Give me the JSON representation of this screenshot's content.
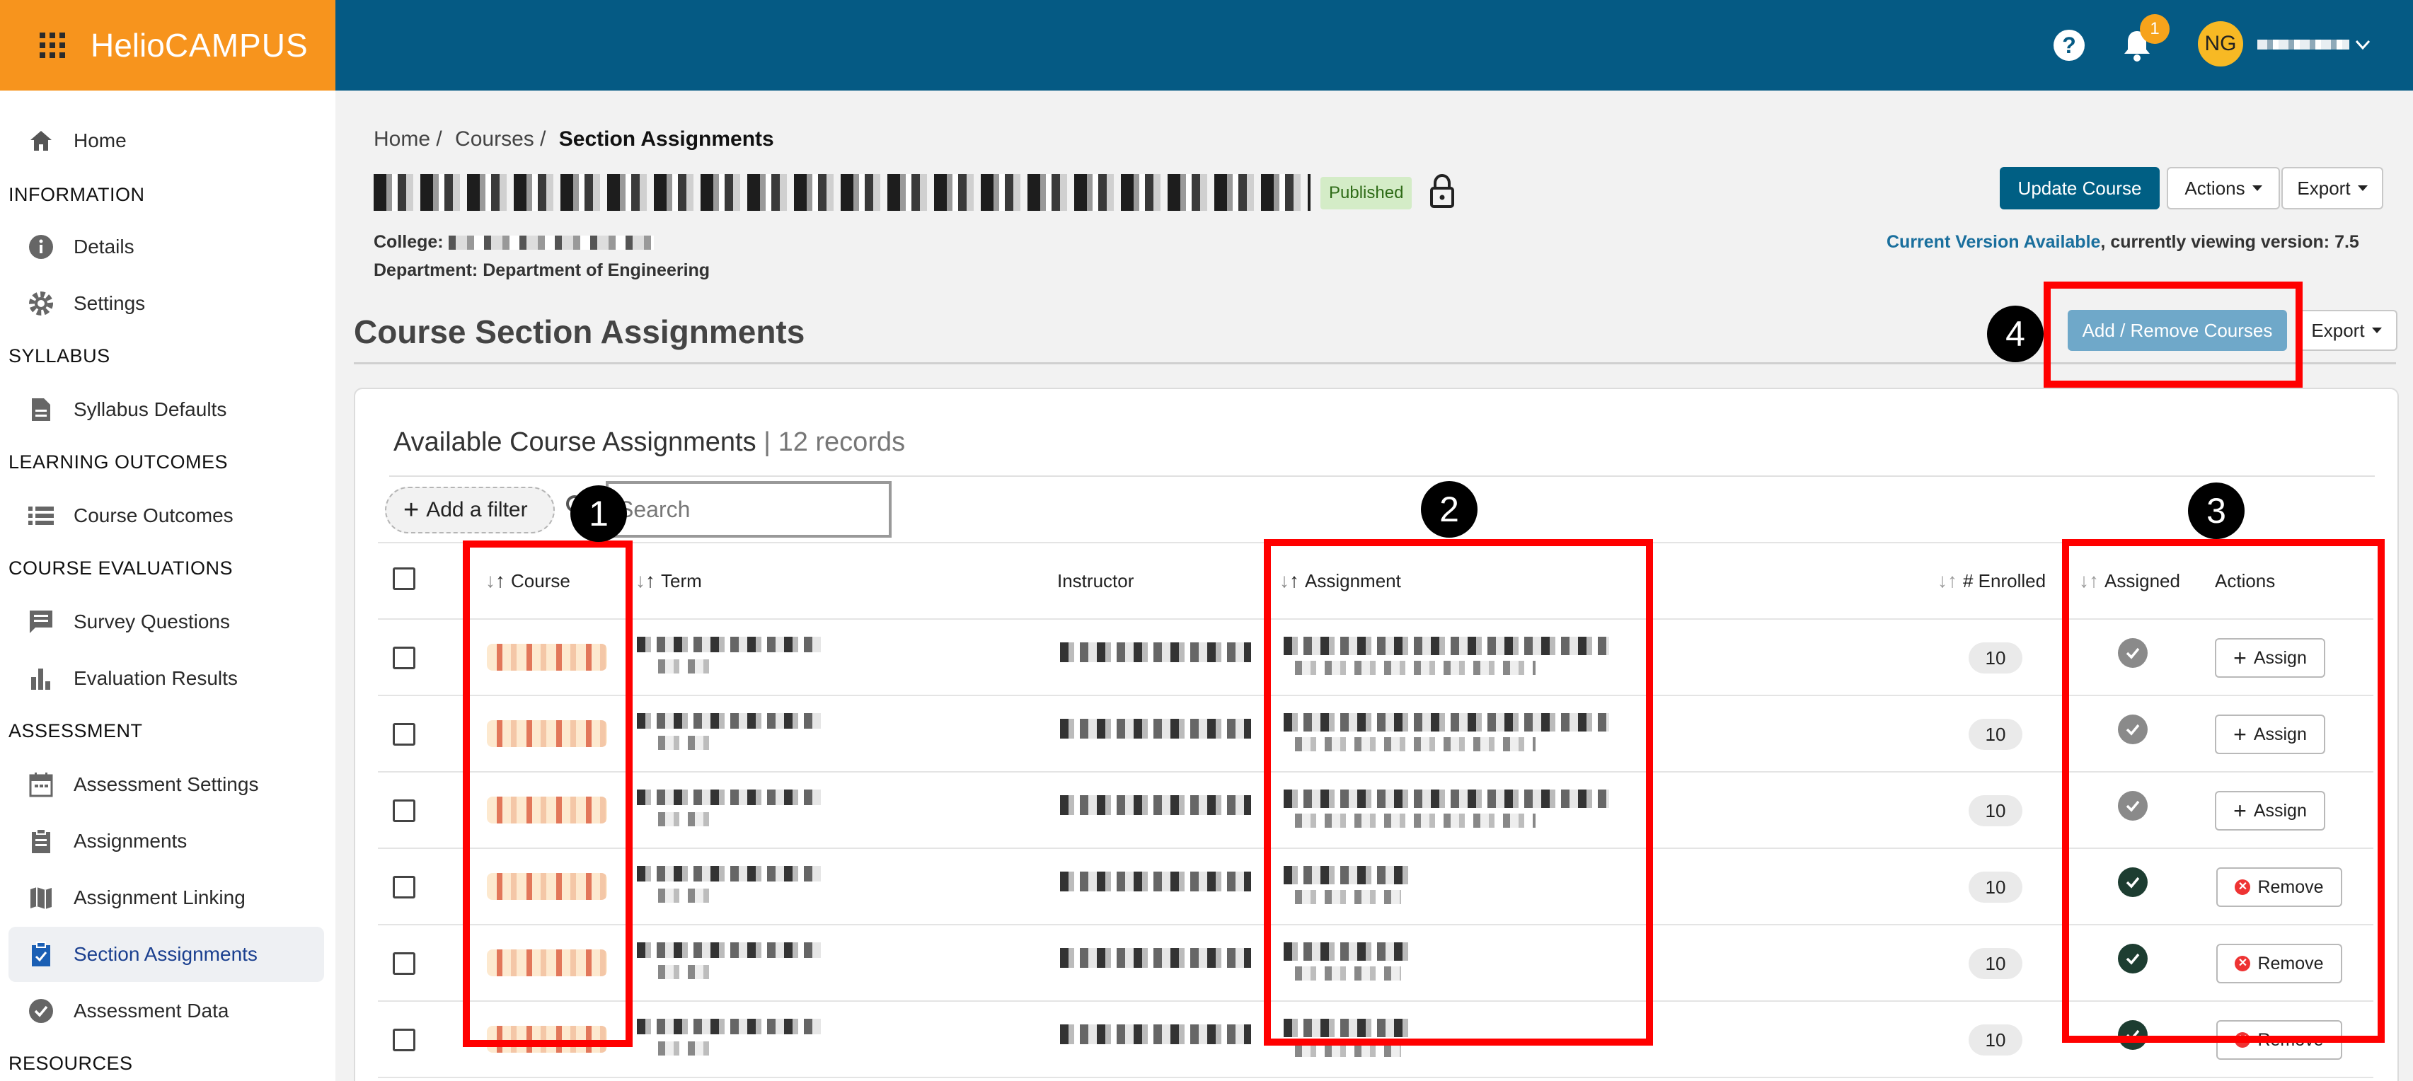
{
  "brand": {
    "logo_part1": "Helio",
    "logo_part2": "CAMPUS"
  },
  "topbar": {
    "help": "?",
    "notification_count": "1",
    "avatar_initials": "NG"
  },
  "sidebar": {
    "home": "Home",
    "sections": [
      {
        "header": "INFORMATION",
        "items": [
          "Details",
          "Settings"
        ]
      },
      {
        "header": "SYLLABUS",
        "items": [
          "Syllabus Defaults"
        ]
      },
      {
        "header": "LEARNING OUTCOMES",
        "items": [
          "Course Outcomes"
        ]
      },
      {
        "header": "COURSE EVALUATIONS",
        "items": [
          "Survey Questions",
          "Evaluation Results"
        ]
      },
      {
        "header": "ASSESSMENT",
        "items": [
          "Assessment Settings",
          "Assignments",
          "Assignment Linking",
          "Section Assignments",
          "Assessment Data"
        ]
      },
      {
        "header": "RESOURCES",
        "items": []
      }
    ],
    "active_item": "Section Assignments"
  },
  "breadcrumb": {
    "home": "Home /",
    "courses": "Courses /",
    "current": "Section Assignments"
  },
  "course": {
    "status": "Published",
    "college_label": "College:",
    "department_label": "Department:",
    "department_value": "Department of Engineering"
  },
  "header_buttons": {
    "update": "Update Course",
    "actions": "Actions",
    "export": "Export"
  },
  "version": {
    "link": "Current Version Available",
    "text": ", currently viewing version: 7.5"
  },
  "section": {
    "title": "Course Section Assignments",
    "add_remove": "Add / Remove Courses",
    "export": "Export"
  },
  "table": {
    "title": "Available Course Assignments",
    "records": "| 12 records",
    "add_filter": "Add a filter",
    "search_placeholder": "Search",
    "columns": {
      "course": "Course",
      "term": "Term",
      "instructor": "Instructor",
      "assignment": "Assignment",
      "enrolled": "# Enrolled",
      "assigned": "Assigned",
      "actions": "Actions"
    },
    "rows": [
      {
        "enrolled": "10",
        "assigned": false,
        "action": "Assign"
      },
      {
        "enrolled": "10",
        "assigned": false,
        "action": "Assign"
      },
      {
        "enrolled": "10",
        "assigned": false,
        "action": "Assign"
      },
      {
        "enrolled": "10",
        "assigned": true,
        "action": "Remove"
      },
      {
        "enrolled": "10",
        "assigned": true,
        "action": "Remove"
      },
      {
        "enrolled": "10",
        "assigned": true,
        "action": "Remove"
      }
    ]
  },
  "annotations": {
    "m1": "1",
    "m2": "2",
    "m3": "3",
    "m4": "4"
  },
  "colors": {
    "brand_orange": "#f7941d",
    "topbar_blue": "#055a84",
    "highlight_red": "#ff0000"
  }
}
